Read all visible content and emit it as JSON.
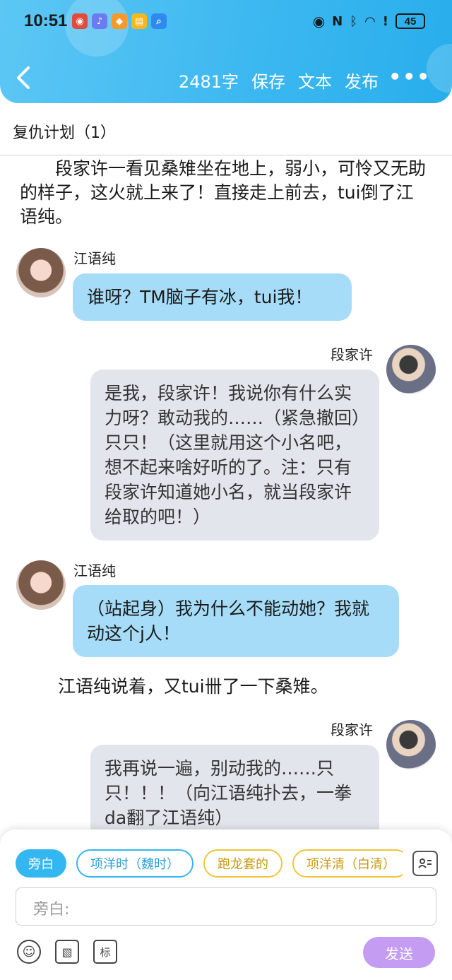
{
  "status_bar": {
    "time": "10:51",
    "battery": "45",
    "app_icons": [
      "weibo-icon",
      "music-icon",
      "shop-icon",
      "notes-icon",
      "search-app-icon"
    ],
    "system_icons": [
      "eye-icon",
      "nfc-icon",
      "bluetooth-icon",
      "wifi-icon",
      "alert-icon"
    ]
  },
  "nav": {
    "back_icon": "back-chevron-icon",
    "word_count": "2481字",
    "save": "保存",
    "text": "文本",
    "publish": "发布",
    "more": "•••"
  },
  "chapter_title": "复仇计划（1）",
  "content": {
    "narration_1": "　　段家许一看见桑雉坐在地上，弱小，可怜又无助的样子，这火就上来了！直接走上前去，tui倒了江语纯。",
    "msg_1": {
      "speaker": "江语纯",
      "text": "谁呀？TM脑子有冰，tui我！"
    },
    "msg_2": {
      "speaker": "段家许",
      "text": "是我，段家许！我说你有什么实力呀？敢动我的……（紧急撤回）只只！（这里就用这个小名吧，想不起来啥好听的了。注：只有段家许知道她小名，就当段家许给取的吧！）"
    },
    "msg_3": {
      "speaker": "江语纯",
      "text": "（站起身）我为什么不能动她？我就动这个j人！"
    },
    "narration_2": "江语纯说着，又tui卌了一下桑雉。",
    "msg_4": {
      "speaker": "段家许",
      "text": "我再说一遍，别动我的……只只！！！（向江语纯扑去，一拳da翻了江语纯）"
    }
  },
  "composer": {
    "chips": [
      "旁白",
      "项洋时（魏时）",
      "跑龙套的",
      "项洋清（白清）"
    ],
    "input_placeholder": "旁白:",
    "contact_icon": "contact-card-icon",
    "tools": {
      "emoji": "☺",
      "image": "▧",
      "tag": "标"
    },
    "send": "发送"
  },
  "colors": {
    "header": "#3db8f0",
    "left_bubble": "#a6dcf8",
    "right_bubble": "#e2e5ec",
    "send_button": "#c49cf2",
    "chip_blue": "#34b6f0",
    "chip_yellow": "#f0c53a"
  }
}
